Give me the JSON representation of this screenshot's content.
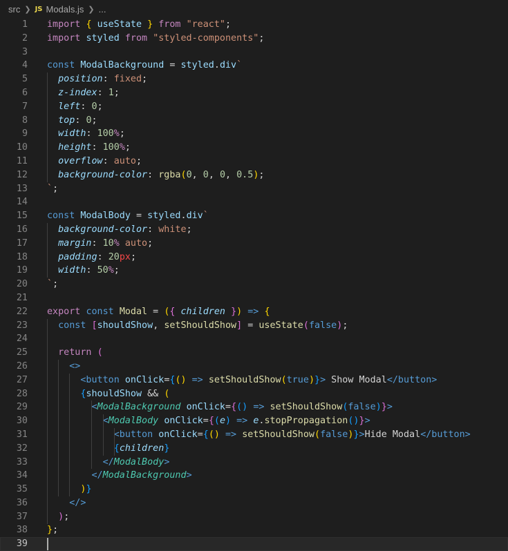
{
  "breadcrumb": {
    "folder": "src",
    "file_icon": "JS",
    "file": "Modals.js",
    "more": "..."
  },
  "editor": {
    "active_line": 39,
    "lines": [
      {
        "n": "1"
      },
      {
        "n": "2"
      },
      {
        "n": "3"
      },
      {
        "n": "4"
      },
      {
        "n": "5"
      },
      {
        "n": "6"
      },
      {
        "n": "7"
      },
      {
        "n": "8"
      },
      {
        "n": "9"
      },
      {
        "n": "10"
      },
      {
        "n": "11"
      },
      {
        "n": "12"
      },
      {
        "n": "13"
      },
      {
        "n": "14"
      },
      {
        "n": "15"
      },
      {
        "n": "16"
      },
      {
        "n": "17"
      },
      {
        "n": "18"
      },
      {
        "n": "19"
      },
      {
        "n": "20"
      },
      {
        "n": "21"
      },
      {
        "n": "22"
      },
      {
        "n": "23"
      },
      {
        "n": "24"
      },
      {
        "n": "25"
      },
      {
        "n": "26"
      },
      {
        "n": "27"
      },
      {
        "n": "28"
      },
      {
        "n": "29"
      },
      {
        "n": "30"
      },
      {
        "n": "31"
      },
      {
        "n": "32"
      },
      {
        "n": "33"
      },
      {
        "n": "34"
      },
      {
        "n": "35"
      },
      {
        "n": "36"
      },
      {
        "n": "37"
      },
      {
        "n": "38"
      },
      {
        "n": "39"
      }
    ],
    "tokens": [
      [
        [
          "kw",
          "import"
        ],
        [
          "pun",
          " "
        ],
        [
          "brk1",
          "{"
        ],
        [
          "pun",
          " "
        ],
        [
          "var",
          "useState"
        ],
        [
          "pun",
          " "
        ],
        [
          "brk1",
          "}"
        ],
        [
          "pun",
          " "
        ],
        [
          "kw",
          "from"
        ],
        [
          "pun",
          " "
        ],
        [
          "str",
          "\"react\""
        ],
        [
          "pun",
          ";"
        ]
      ],
      [
        [
          "kw",
          "import"
        ],
        [
          "pun",
          " "
        ],
        [
          "var",
          "styled"
        ],
        [
          "pun",
          " "
        ],
        [
          "kw",
          "from"
        ],
        [
          "pun",
          " "
        ],
        [
          "str",
          "\"styled-components\""
        ],
        [
          "pun",
          ";"
        ]
      ],
      [],
      [
        [
          "st",
          "const"
        ],
        [
          "pun",
          " "
        ],
        [
          "var",
          "ModalBackground"
        ],
        [
          "pun",
          " = "
        ],
        [
          "var",
          "styled"
        ],
        [
          "pun",
          "."
        ],
        [
          "var",
          "div"
        ],
        [
          "str",
          "`"
        ]
      ],
      [
        [
          "pun",
          "  "
        ],
        [
          "prop",
          "position"
        ],
        [
          "pun",
          ": "
        ],
        [
          "str",
          "fixed"
        ],
        [
          "pun",
          ";"
        ]
      ],
      [
        [
          "pun",
          "  "
        ],
        [
          "prop",
          "z-index"
        ],
        [
          "pun",
          ": "
        ],
        [
          "num",
          "1"
        ],
        [
          "pun",
          ";"
        ]
      ],
      [
        [
          "pun",
          "  "
        ],
        [
          "prop",
          "left"
        ],
        [
          "pun",
          ": "
        ],
        [
          "num",
          "0"
        ],
        [
          "pun",
          ";"
        ]
      ],
      [
        [
          "pun",
          "  "
        ],
        [
          "prop",
          "top"
        ],
        [
          "pun",
          ": "
        ],
        [
          "num",
          "0"
        ],
        [
          "pun",
          ";"
        ]
      ],
      [
        [
          "pun",
          "  "
        ],
        [
          "prop",
          "width"
        ],
        [
          "pun",
          ": "
        ],
        [
          "num",
          "100"
        ],
        [
          "kw",
          "%"
        ],
        [
          "pun",
          ";"
        ]
      ],
      [
        [
          "pun",
          "  "
        ],
        [
          "prop",
          "height"
        ],
        [
          "pun",
          ": "
        ],
        [
          "num",
          "100"
        ],
        [
          "kw",
          "%"
        ],
        [
          "pun",
          ";"
        ]
      ],
      [
        [
          "pun",
          "  "
        ],
        [
          "prop",
          "overflow"
        ],
        [
          "pun",
          ": "
        ],
        [
          "str",
          "auto"
        ],
        [
          "pun",
          ";"
        ]
      ],
      [
        [
          "pun",
          "  "
        ],
        [
          "prop",
          "background-color"
        ],
        [
          "pun",
          ": "
        ],
        [
          "fn",
          "rgba"
        ],
        [
          "brk1",
          "("
        ],
        [
          "num",
          "0"
        ],
        [
          "pun",
          ", "
        ],
        [
          "num",
          "0"
        ],
        [
          "pun",
          ", "
        ],
        [
          "num",
          "0"
        ],
        [
          "pun",
          ", "
        ],
        [
          "num",
          "0.5"
        ],
        [
          "brk1",
          ")"
        ],
        [
          "pun",
          ";"
        ]
      ],
      [
        [
          "str",
          "`"
        ],
        [
          "pun",
          ";"
        ]
      ],
      [],
      [
        [
          "st",
          "const"
        ],
        [
          "pun",
          " "
        ],
        [
          "var",
          "ModalBody"
        ],
        [
          "pun",
          " = "
        ],
        [
          "var",
          "styled"
        ],
        [
          "pun",
          "."
        ],
        [
          "var",
          "div"
        ],
        [
          "str",
          "`"
        ]
      ],
      [
        [
          "pun",
          "  "
        ],
        [
          "prop",
          "background-color"
        ],
        [
          "pun",
          ": "
        ],
        [
          "str",
          "white"
        ],
        [
          "pun",
          ";"
        ]
      ],
      [
        [
          "pun",
          "  "
        ],
        [
          "prop",
          "margin"
        ],
        [
          "pun",
          ": "
        ],
        [
          "num",
          "10"
        ],
        [
          "kw",
          "%"
        ],
        [
          "pun",
          " "
        ],
        [
          "str",
          "auto"
        ],
        [
          "pun",
          ";"
        ]
      ],
      [
        [
          "pun",
          "  "
        ],
        [
          "prop",
          "padding"
        ],
        [
          "pun",
          ": "
        ],
        [
          "num",
          "20"
        ],
        [
          "par",
          "px"
        ],
        [
          "pun",
          ";"
        ]
      ],
      [
        [
          "pun",
          "  "
        ],
        [
          "prop",
          "width"
        ],
        [
          "pun",
          ": "
        ],
        [
          "num",
          "50"
        ],
        [
          "kw",
          "%"
        ],
        [
          "pun",
          ";"
        ]
      ],
      [
        [
          "str",
          "`"
        ],
        [
          "pun",
          ";"
        ]
      ],
      [],
      [
        [
          "kw",
          "export"
        ],
        [
          "pun",
          " "
        ],
        [
          "st",
          "const"
        ],
        [
          "pun",
          " "
        ],
        [
          "fn",
          "Modal"
        ],
        [
          "pun",
          " = "
        ],
        [
          "brk1",
          "("
        ],
        [
          "brk2",
          "{"
        ],
        [
          "pun",
          " "
        ],
        [
          "prop",
          "children"
        ],
        [
          "pun",
          " "
        ],
        [
          "brk2",
          "}"
        ],
        [
          "brk1",
          ")"
        ],
        [
          "pun",
          " "
        ],
        [
          "st",
          "=>"
        ],
        [
          "pun",
          " "
        ],
        [
          "brk1",
          "{"
        ]
      ],
      [
        [
          "pun",
          "  "
        ],
        [
          "st",
          "const"
        ],
        [
          "pun",
          " "
        ],
        [
          "brk2",
          "["
        ],
        [
          "var",
          "shouldShow"
        ],
        [
          "pun",
          ", "
        ],
        [
          "fn",
          "setShouldShow"
        ],
        [
          "brk2",
          "]"
        ],
        [
          "pun",
          " = "
        ],
        [
          "fn",
          "useState"
        ],
        [
          "brk2",
          "("
        ],
        [
          "st",
          "false"
        ],
        [
          "brk2",
          ")"
        ],
        [
          "pun",
          ";"
        ]
      ],
      [],
      [
        [
          "pun",
          "  "
        ],
        [
          "kw",
          "return"
        ],
        [
          "pun",
          " "
        ],
        [
          "brk2",
          "("
        ]
      ],
      [
        [
          "pun",
          "    "
        ],
        [
          "tag",
          "<>"
        ]
      ],
      [
        [
          "pun",
          "      "
        ],
        [
          "tag",
          "<button"
        ],
        [
          "pun",
          " "
        ],
        [
          "attr",
          "onClick"
        ],
        [
          "pun",
          "="
        ],
        [
          "brk3",
          "{"
        ],
        [
          "brk1",
          "()"
        ],
        [
          "pun",
          " "
        ],
        [
          "st",
          "=>"
        ],
        [
          "pun",
          " "
        ],
        [
          "fn",
          "setShouldShow"
        ],
        [
          "brk1",
          "("
        ],
        [
          "st",
          "true"
        ],
        [
          "brk1",
          ")"
        ],
        [
          "brk3",
          "}"
        ],
        [
          "tag",
          ">"
        ],
        [
          "pun",
          " Show Modal"
        ],
        [
          "tag",
          "</button>"
        ]
      ],
      [
        [
          "pun",
          "      "
        ],
        [
          "brk3",
          "{"
        ],
        [
          "var",
          "shouldShow"
        ],
        [
          "pun",
          " && "
        ],
        [
          "brk1",
          "("
        ]
      ],
      [
        [
          "pun",
          "        "
        ],
        [
          "tag",
          "<"
        ],
        [
          "comp",
          "ModalBackground"
        ],
        [
          "pun",
          " "
        ],
        [
          "attr",
          "onClick"
        ],
        [
          "pun",
          "="
        ],
        [
          "brk2",
          "{"
        ],
        [
          "brk3",
          "()"
        ],
        [
          "pun",
          " "
        ],
        [
          "st",
          "=>"
        ],
        [
          "pun",
          " "
        ],
        [
          "fn",
          "setShouldShow"
        ],
        [
          "brk3",
          "("
        ],
        [
          "st",
          "false"
        ],
        [
          "brk3",
          ")"
        ],
        [
          "brk2",
          "}"
        ],
        [
          "tag",
          ">"
        ]
      ],
      [
        [
          "pun",
          "          "
        ],
        [
          "tag",
          "<"
        ],
        [
          "comp",
          "ModalBody"
        ],
        [
          "pun",
          " "
        ],
        [
          "attr",
          "onClick"
        ],
        [
          "pun",
          "="
        ],
        [
          "brk2",
          "{"
        ],
        [
          "brk3",
          "("
        ],
        [
          "prop",
          "e"
        ],
        [
          "brk3",
          ")"
        ],
        [
          "pun",
          " "
        ],
        [
          "st",
          "=>"
        ],
        [
          "pun",
          " "
        ],
        [
          "prop",
          "e"
        ],
        [
          "pun",
          "."
        ],
        [
          "fn",
          "stopPropagation"
        ],
        [
          "brk3",
          "()"
        ],
        [
          "brk2",
          "}"
        ],
        [
          "tag",
          ">"
        ]
      ],
      [
        [
          "pun",
          "            "
        ],
        [
          "tag",
          "<button"
        ],
        [
          "pun",
          " "
        ],
        [
          "attr",
          "onClick"
        ],
        [
          "pun",
          "="
        ],
        [
          "brk3",
          "{"
        ],
        [
          "brk1",
          "()"
        ],
        [
          "pun",
          " "
        ],
        [
          "st",
          "=>"
        ],
        [
          "pun",
          " "
        ],
        [
          "fn",
          "setShouldShow"
        ],
        [
          "brk1",
          "("
        ],
        [
          "st",
          "false"
        ],
        [
          "brk1",
          ")"
        ],
        [
          "brk3",
          "}"
        ],
        [
          "tag",
          ">"
        ],
        [
          "pun",
          "Hide Modal"
        ],
        [
          "tag",
          "</button>"
        ]
      ],
      [
        [
          "pun",
          "            "
        ],
        [
          "brk3",
          "{"
        ],
        [
          "prop",
          "children"
        ],
        [
          "brk3",
          "}"
        ]
      ],
      [
        [
          "pun",
          "          "
        ],
        [
          "tag",
          "</"
        ],
        [
          "comp",
          "ModalBody"
        ],
        [
          "tag",
          ">"
        ]
      ],
      [
        [
          "pun",
          "        "
        ],
        [
          "tag",
          "</"
        ],
        [
          "comp",
          "ModalBackground"
        ],
        [
          "tag",
          ">"
        ]
      ],
      [
        [
          "pun",
          "      "
        ],
        [
          "brk1",
          ")"
        ],
        [
          "brk3",
          "}"
        ]
      ],
      [
        [
          "pun",
          "    "
        ],
        [
          "tag",
          "</>"
        ]
      ],
      [
        [
          "pun",
          "  "
        ],
        [
          "brk2",
          ")"
        ],
        [
          "pun",
          ";"
        ]
      ],
      [
        [
          "brk1",
          "}"
        ],
        [
          "pun",
          ";"
        ]
      ],
      []
    ]
  }
}
